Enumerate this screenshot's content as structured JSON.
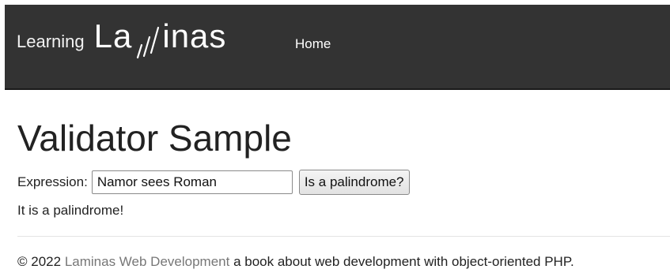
{
  "navbar": {
    "brand_prefix": "Learning",
    "logo_text_left": "La",
    "logo_text_right": "inas",
    "home_label": "Home",
    "background_color": "#333333"
  },
  "main": {
    "title": "Validator Sample",
    "form": {
      "label": "Expression:",
      "input_value": "Namor sees Roman",
      "submit_label": "Is a palindrome?"
    },
    "result": "It is a palindrome!"
  },
  "footer": {
    "copyright": "© 2022",
    "link_text": "Laminas Web Development",
    "tagline": "a book about web development with object-oriented PHP."
  }
}
